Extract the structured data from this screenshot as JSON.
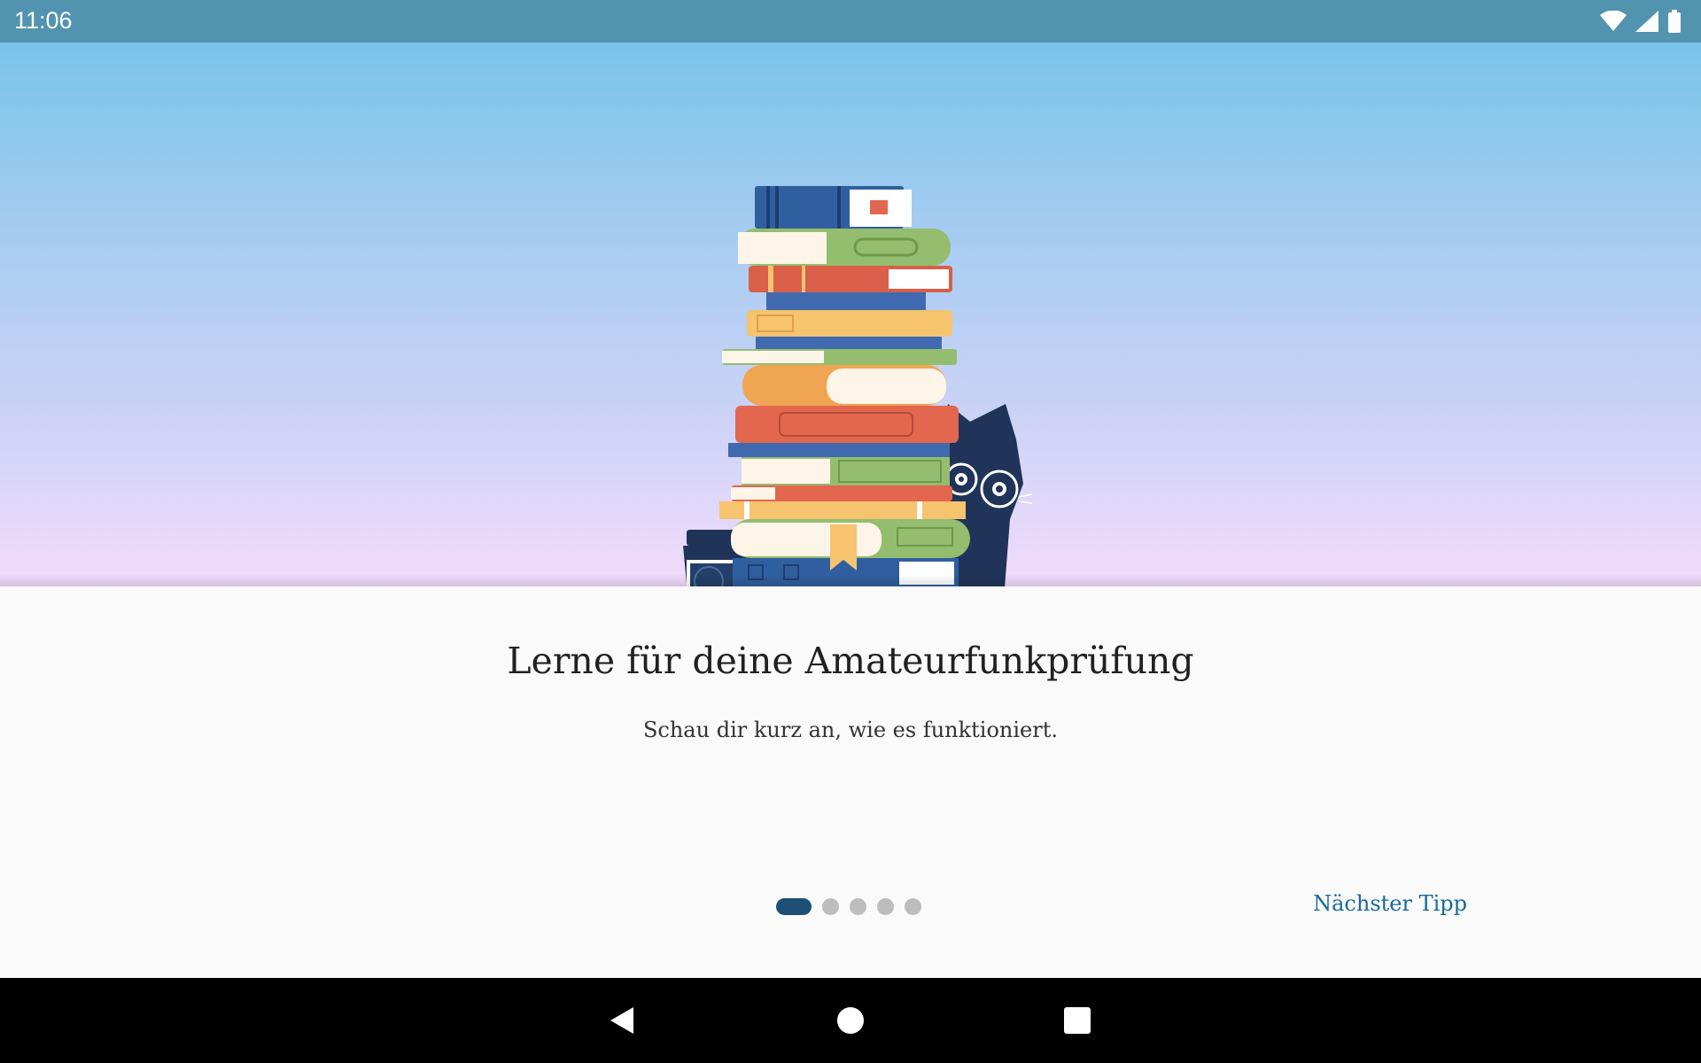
{
  "status_bar": {
    "time": "11:06",
    "icons": [
      "wifi-icon",
      "signal-icon",
      "battery-icon"
    ]
  },
  "hero": {
    "illustration": "book-stack-with-cat-illustration",
    "colors": {
      "sky_top": "#79c4e9",
      "sky_bottom": "#f2dcfc"
    }
  },
  "onboarding": {
    "title": "Lerne für deine Amateurfunkprüfung",
    "subtitle": "Schau dir kurz an, wie es funktioniert.",
    "page_count": 5,
    "current_page": 1,
    "next_label": "Nächster Tipp",
    "accent_color": "#176b98",
    "indicator_active_color": "#1d4f75"
  },
  "nav_bar": {
    "buttons": [
      "back-icon",
      "home-icon",
      "recents-icon"
    ]
  }
}
